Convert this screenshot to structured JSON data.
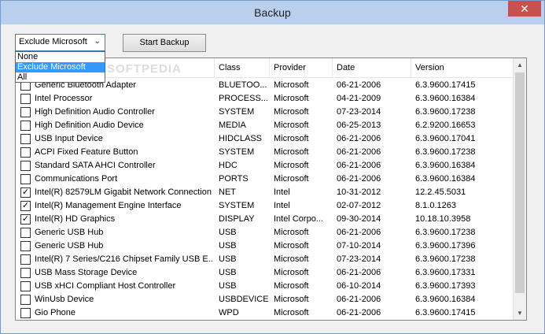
{
  "window": {
    "title": "Backup",
    "close_glyph": "✕"
  },
  "filter": {
    "selected": "Exclude Microsoft",
    "arrow_glyph": "⌄",
    "options": [
      "None",
      "Exclude Microsoft",
      "All"
    ]
  },
  "toolbar": {
    "start_backup_label": "Start Backup"
  },
  "watermark": "SOFTPEDIA",
  "table": {
    "columns": [
      "",
      "Class",
      "Provider",
      "Date",
      "Version"
    ],
    "rows": [
      {
        "checked": false,
        "name": "Generic Bluetooth Adapter",
        "class": "BLUETOO...",
        "provider": "Microsoft",
        "date": "06-21-2006",
        "version": "6.3.9600.17415"
      },
      {
        "checked": false,
        "name": "Intel Processor",
        "class": "PROCESS...",
        "provider": "Microsoft",
        "date": "04-21-2009",
        "version": "6.3.9600.16384"
      },
      {
        "checked": false,
        "name": "High Definition Audio Controller",
        "class": "SYSTEM",
        "provider": "Microsoft",
        "date": "07-23-2014",
        "version": "6.3.9600.17238"
      },
      {
        "checked": false,
        "name": "High Definition Audio Device",
        "class": "MEDIA",
        "provider": "Microsoft",
        "date": "06-25-2013",
        "version": "6.2.9200.16653"
      },
      {
        "checked": false,
        "name": "USB Input Device",
        "class": "HIDCLASS",
        "provider": "Microsoft",
        "date": "06-21-2006",
        "version": "6.3.9600.17041"
      },
      {
        "checked": false,
        "name": "ACPI Fixed Feature Button",
        "class": "SYSTEM",
        "provider": "Microsoft",
        "date": "06-21-2006",
        "version": "6.3.9600.17238"
      },
      {
        "checked": false,
        "name": "Standard SATA AHCI Controller",
        "class": "HDC",
        "provider": "Microsoft",
        "date": "06-21-2006",
        "version": "6.3.9600.16384"
      },
      {
        "checked": false,
        "name": "Communications Port",
        "class": "PORTS",
        "provider": "Microsoft",
        "date": "06-21-2006",
        "version": "6.3.9600.16384"
      },
      {
        "checked": true,
        "name": "Intel(R) 82579LM Gigabit Network Connection",
        "class": "NET",
        "provider": "Intel",
        "date": "10-31-2012",
        "version": "12.2.45.5031"
      },
      {
        "checked": true,
        "name": "Intel(R) Management Engine Interface",
        "class": "SYSTEM",
        "provider": "Intel",
        "date": "02-07-2012",
        "version": "8.1.0.1263"
      },
      {
        "checked": true,
        "name": "Intel(R) HD Graphics",
        "class": "DISPLAY",
        "provider": "Intel Corpo...",
        "date": "09-30-2014",
        "version": "10.18.10.3958"
      },
      {
        "checked": false,
        "name": "Generic USB Hub",
        "class": "USB",
        "provider": "Microsoft",
        "date": "06-21-2006",
        "version": "6.3.9600.17238"
      },
      {
        "checked": false,
        "name": "Generic USB Hub",
        "class": "USB",
        "provider": "Microsoft",
        "date": "07-10-2014",
        "version": "6.3.9600.17396"
      },
      {
        "checked": false,
        "name": "Intel(R) 7 Series/C216 Chipset Family USB E...",
        "class": "USB",
        "provider": "Microsoft",
        "date": "07-23-2014",
        "version": "6.3.9600.17238"
      },
      {
        "checked": false,
        "name": "USB Mass Storage Device",
        "class": "USB",
        "provider": "Microsoft",
        "date": "06-21-2006",
        "version": "6.3.9600.17331"
      },
      {
        "checked": false,
        "name": "USB xHCI Compliant Host Controller",
        "class": "USB",
        "provider": "Microsoft",
        "date": "06-10-2014",
        "version": "6.3.9600.17393"
      },
      {
        "checked": false,
        "name": "WinUsb Device",
        "class": "USBDEVICE",
        "provider": "Microsoft",
        "date": "06-21-2006",
        "version": "6.3.9600.16384"
      },
      {
        "checked": false,
        "name": "Gio Phone",
        "class": "WPD",
        "provider": "Microsoft",
        "date": "06-21-2006",
        "version": "6.3.9600.17415"
      }
    ]
  },
  "scrollbar": {
    "up_glyph": "▲",
    "down_glyph": "▼"
  },
  "check_glyph": "✓"
}
